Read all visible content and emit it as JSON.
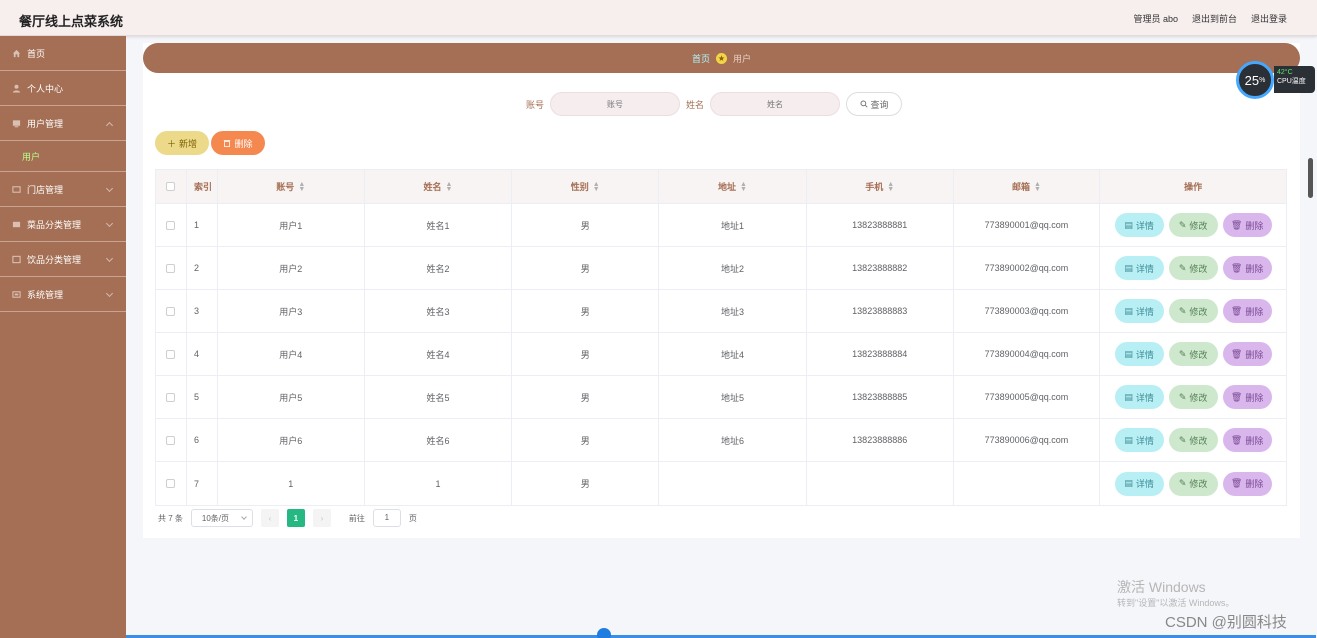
{
  "app": {
    "title": "餐厅线上点菜系统"
  },
  "top_links": {
    "admin": "管理员 abo",
    "front": "退出到前台",
    "logout": "退出登录"
  },
  "sidebar": {
    "items": [
      {
        "label": "首页",
        "icon": "home-icon"
      },
      {
        "label": "个人中心",
        "icon": "user-icon"
      },
      {
        "label": "用户管理",
        "icon": "menu-icon",
        "expanded": true,
        "sub": [
          {
            "label": "用户",
            "active": true
          }
        ]
      },
      {
        "label": "门店管理",
        "icon": "menu-icon"
      },
      {
        "label": "菜品分类管理",
        "icon": "menu-icon"
      },
      {
        "label": "饮品分类管理",
        "icon": "menu-icon"
      },
      {
        "label": "系统管理",
        "icon": "menu-icon"
      }
    ]
  },
  "breadcrumb": {
    "home": "首页",
    "current": "用户"
  },
  "search": {
    "account_label": "账号",
    "account_placeholder": "账号",
    "name_label": "姓名",
    "name_placeholder": "姓名",
    "button": "查询"
  },
  "actions": {
    "add": "新增",
    "delete": "删除"
  },
  "table": {
    "headers": {
      "index": "索引",
      "account": "账号",
      "name": "姓名",
      "gender": "性别",
      "address": "地址",
      "phone": "手机",
      "email": "邮箱",
      "ops": "操作"
    },
    "rows": [
      {
        "index": "1",
        "account": "用户1",
        "name": "姓名1",
        "gender": "男",
        "address": "地址1",
        "phone": "13823888881",
        "email": "773890001@qq.com"
      },
      {
        "index": "2",
        "account": "用户2",
        "name": "姓名2",
        "gender": "男",
        "address": "地址2",
        "phone": "13823888882",
        "email": "773890002@qq.com"
      },
      {
        "index": "3",
        "account": "用户3",
        "name": "姓名3",
        "gender": "男",
        "address": "地址3",
        "phone": "13823888883",
        "email": "773890003@qq.com"
      },
      {
        "index": "4",
        "account": "用户4",
        "name": "姓名4",
        "gender": "男",
        "address": "地址4",
        "phone": "13823888884",
        "email": "773890004@qq.com"
      },
      {
        "index": "5",
        "account": "用户5",
        "name": "姓名5",
        "gender": "男",
        "address": "地址5",
        "phone": "13823888885",
        "email": "773890005@qq.com"
      },
      {
        "index": "6",
        "account": "用户6",
        "name": "姓名6",
        "gender": "男",
        "address": "地址6",
        "phone": "13823888886",
        "email": "773890006@qq.com"
      },
      {
        "index": "7",
        "account": "1",
        "name": "1",
        "gender": "男",
        "address": "",
        "phone": "",
        "email": ""
      }
    ],
    "row_ops": {
      "detail": "详情",
      "edit": "修改",
      "delete": "删除"
    }
  },
  "pagination": {
    "total": "共 7 条",
    "page_size": "10条/页",
    "current_page": "1",
    "goto_label": "前往",
    "goto_value": "1",
    "goto_suffix": "页"
  },
  "cpu_widget": {
    "percent": "25",
    "percent_unit": "%",
    "temp": "42°C",
    "label": "CPU温度"
  },
  "watermark": {
    "line1": "激活 Windows",
    "line2": "转到\"设置\"以激活 Windows。",
    "csdn": "CSDN @别圆科技"
  },
  "colors": {
    "sidebar": "#a46f54",
    "topbar": "#f7eeee",
    "accent_green": "#25b883"
  }
}
